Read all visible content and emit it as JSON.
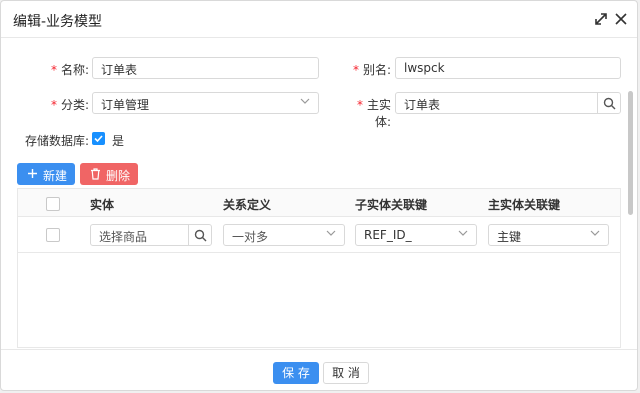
{
  "dialog": {
    "title": "编辑-业务模型",
    "icons": [
      "expand-icon",
      "close-icon"
    ]
  },
  "form": {
    "name": {
      "label": "名称:",
      "value": "订单表",
      "required": true
    },
    "alias": {
      "label": "别名:",
      "value": "lwspck",
      "required": true
    },
    "category": {
      "label": "分类:",
      "value": "订单管理",
      "required": true
    },
    "main_entity": {
      "label": "主实体:",
      "value": "订单表",
      "required": true
    },
    "store_db": {
      "label": "存储数据库:",
      "checked": true,
      "option_label": "是"
    }
  },
  "toolbar": {
    "new_label": "新建",
    "delete_label": "删除"
  },
  "table": {
    "columns": [
      "实体",
      "关系定义",
      "子实体关联键",
      "主实体关联键"
    ],
    "rows": [
      {
        "entity_placeholder": "选择商品",
        "relation": "一对多",
        "child_key": "REF_ID_",
        "main_key": "主键"
      }
    ]
  },
  "footer": {
    "save_label": "保 存",
    "cancel_label": "取 消"
  },
  "colors": {
    "primary": "#3b8ff0",
    "danger": "#f06565",
    "required": "#f5222d"
  }
}
